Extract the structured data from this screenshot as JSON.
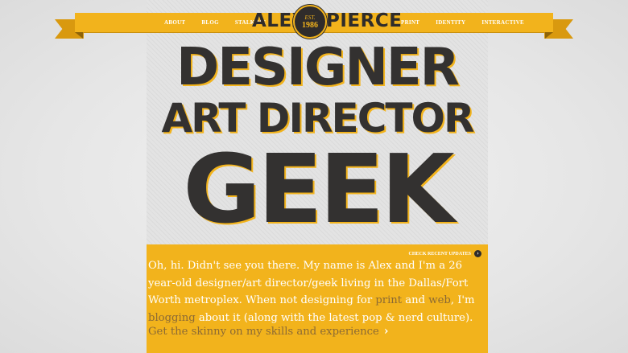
{
  "nav": {
    "left": [
      "ABOUT",
      "BLOG",
      "STALK ME"
    ],
    "right": [
      "PRINT",
      "IDENTITY",
      "INTERACTIVE"
    ]
  },
  "logo": {
    "first": "ALEX",
    "last": "PIERCE",
    "est": "EST.",
    "year": "1986"
  },
  "headline": {
    "line1": "DESIGNER",
    "line2": "ART DIRECTOR",
    "line3": "GEEK"
  },
  "bio": {
    "updates_label": "CHECK RECENT UPDATES",
    "updates_icon": "chevron-right-icon",
    "part1": "Oh, hi. Didn't see you there. My name is Alex and I'm a 26 year-old designer/art director/geek living in the Dallas/Fort Worth metroplex. When not designing for ",
    "link_print": "print",
    "and": " and ",
    "link_web": "web",
    "part2": ", I'm ",
    "link_blogging": "blogging",
    "part3": " about it (along with the latest pop & nerd culture).",
    "skinny_link": "Get the skinny on my skills and experience",
    "skinny_icon": "chevron-right-icon"
  },
  "colors": {
    "accent": "#f2b31c",
    "dark": "#2f2c2b",
    "link": "#8b6a35"
  }
}
